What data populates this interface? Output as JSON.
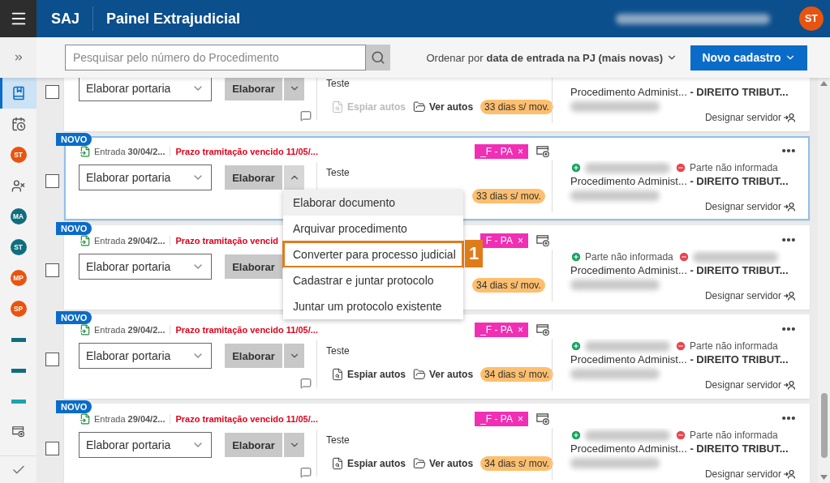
{
  "header": {
    "app": "SAJ",
    "title": "Painel Extrajudicial",
    "avatar": {
      "initials": "ST",
      "color": "#e8540f"
    }
  },
  "toolbar": {
    "search": {
      "placeholder": "Pesquisar pelo número do Procedimento"
    },
    "sort": {
      "label": "Ordenar por",
      "value": "data de entrada na PJ (mais novas)"
    },
    "new_button": "Novo cadastro"
  },
  "sidebar": {
    "items": [
      {
        "kind": "bookmarks",
        "selected": true
      },
      {
        "kind": "calendar",
        "selected": false
      },
      {
        "kind": "avatar",
        "initials": "ST",
        "color": "#e8540f",
        "selected": false
      },
      {
        "kind": "user-remove",
        "selected": false
      },
      {
        "kind": "avatar",
        "initials": "MA",
        "color": "#0e6e7e",
        "selected": false
      },
      {
        "kind": "avatar",
        "initials": "ST",
        "color": "#0e6e7e",
        "selected": false
      },
      {
        "kind": "avatar",
        "initials": "MP",
        "color": "#e8540f",
        "selected": false
      },
      {
        "kind": "avatar",
        "initials": "SP",
        "color": "#e8540f",
        "selected": false
      },
      {
        "kind": "bar",
        "color": "#0e6e7e",
        "selected": false
      },
      {
        "kind": "bar",
        "color": "#0e6e7e",
        "selected": false
      },
      {
        "kind": "bar",
        "color": "#1aa3b0",
        "selected": false
      },
      {
        "kind": "window-add",
        "selected": false
      }
    ],
    "confirm": true
  },
  "cards": [
    {
      "checked": false,
      "selected": false,
      "select": "Elaborar portaria",
      "action": "Elaborar",
      "description": "Teste",
      "links": [
        {
          "kind": "peek",
          "label": "Espiar autos",
          "disabled": true
        },
        {
          "kind": "folder",
          "label": "Ver autos",
          "disabled": false
        }
      ],
      "idle": "33 dias s/ mov.",
      "procedure": "Procedimento Administ...",
      "subject": "- DIREITO TRIBUT...",
      "assign": "Designar servidor"
    },
    {
      "checked": false,
      "selected": true,
      "badge": "NOVO",
      "entry": {
        "label": "Entrada",
        "date": "30/04/2..."
      },
      "deadline": "Prazo tramitação vencido 11/05/...",
      "tag": {
        "label": "_F - PA",
        "remove": "×",
        "color": "#f02fb4"
      },
      "select": "Elaborar portaria",
      "action": "Elaborar",
      "description": "Teste",
      "idle": "33 dias s/ mov.",
      "parties": [
        {
          "kind": "plus",
          "redacted": true
        },
        {
          "kind": "minus",
          "redacted": false,
          "name": "Parte não informada"
        }
      ],
      "procedure": "Procedimento Administ...",
      "subject": "- DIREITO TRIBUT...",
      "assign": "Designar servidor",
      "menu": [
        {
          "label": "Elaborar documento",
          "highlighted": true
        },
        {
          "label": "Arquivar procedimento",
          "highlighted": false
        },
        {
          "label": "Converter para processo judicial",
          "highlighted": false,
          "callout": "1"
        },
        {
          "label": "Cadastrar e juntar protocolo",
          "highlighted": false
        },
        {
          "label": "Juntar um protocolo existente",
          "highlighted": false
        }
      ]
    },
    {
      "checked": false,
      "selected": false,
      "badge": "NOVO",
      "entry": {
        "label": "Entrada",
        "date": "29/04/2..."
      },
      "deadline": "Prazo tramitação vencid",
      "tag": {
        "label": "F - PA",
        "remove": "×",
        "color": "#f02fb4"
      },
      "select": "Elaborar portaria",
      "action": "Elaborar",
      "caret": false,
      "idle": "34 dias s/ mov.",
      "parties": [
        {
          "kind": "plus",
          "redacted": false,
          "name": "Parte não informada"
        },
        {
          "kind": "minus",
          "redacted": true
        }
      ],
      "procedure": "Procedimento Administ...",
      "subject": "- DIREITO TRIBUT...",
      "assign": "Designar servidor"
    },
    {
      "checked": false,
      "selected": false,
      "badge": "NOVO",
      "entry": {
        "label": "Entrada",
        "date": "29/04/2..."
      },
      "deadline": "Prazo tramitação vencido 11/05/...",
      "tag": {
        "label": "_F - PA",
        "remove": "×",
        "color": "#f02fb4"
      },
      "select": "Elaborar portaria",
      "action": "Elaborar",
      "description": "Teste",
      "links": [
        {
          "kind": "peek",
          "label": "Espiar autos",
          "disabled": false
        },
        {
          "kind": "folder",
          "label": "Ver autos",
          "disabled": false
        }
      ],
      "idle": "34 dias s/ mov.",
      "parties": [
        {
          "kind": "plus",
          "redacted": true
        },
        {
          "kind": "minus",
          "redacted": false,
          "name": "Parte não informada"
        }
      ],
      "procedure": "Procedimento Administ...",
      "subject": "- DIREITO TRIBUT...",
      "assign": "Designar servidor"
    },
    {
      "checked": false,
      "selected": false,
      "badge": "NOVO",
      "entry": {
        "label": "Entrada",
        "date": "29/04/2..."
      },
      "deadline": "Prazo tramitação vencido 11/05/...",
      "tag": {
        "label": "_F - PA",
        "remove": "×",
        "color": "#f02fb4"
      },
      "select": "Elaborar portaria",
      "action": "Elaborar",
      "description": "Teste",
      "links": [
        {
          "kind": "peek",
          "label": "Espiar autos",
          "disabled": false
        },
        {
          "kind": "folder",
          "label": "Ver autos",
          "disabled": false
        }
      ],
      "idle": "34 dias s/ mov.",
      "parties": [
        {
          "kind": "plus",
          "redacted": true
        },
        {
          "kind": "minus",
          "redacted": false,
          "name": "Parte não informada"
        }
      ],
      "procedure": "Procedimento Administ...",
      "subject": "- DIREITO TRIBUT...",
      "assign": "Designar servidor"
    }
  ]
}
